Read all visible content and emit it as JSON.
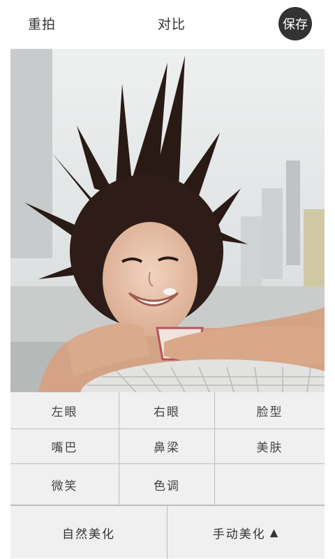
{
  "header": {
    "retake_label": "重拍",
    "compare_label": "对比",
    "save_label": "保存"
  },
  "features": [
    {
      "label": "左眼"
    },
    {
      "label": "右眼"
    },
    {
      "label": "脸型"
    },
    {
      "label": "嘴巴"
    },
    {
      "label": "鼻梁"
    },
    {
      "label": "美肤"
    },
    {
      "label": "微笑"
    },
    {
      "label": "色调"
    }
  ],
  "modes": {
    "natural_label": "自然美化",
    "manual_label": "手动美化",
    "manual_indicator": "▲"
  },
  "colors": {
    "save_button_bg": "#333333",
    "panel_bg": "#f0f0f0",
    "divider": "#bdbdbd"
  }
}
